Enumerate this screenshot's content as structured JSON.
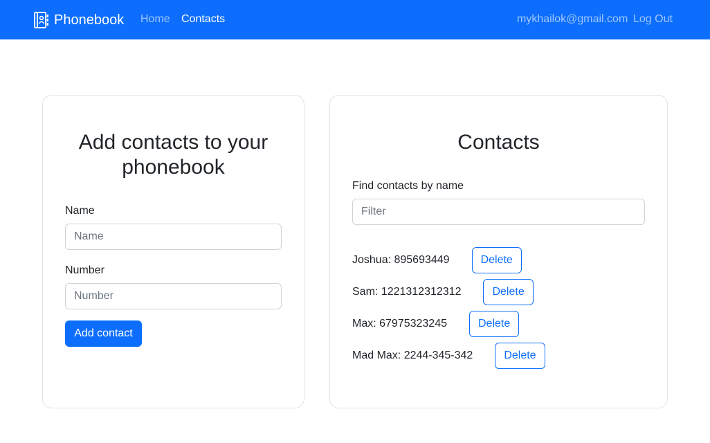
{
  "navbar": {
    "brand": "Phonebook",
    "links": [
      "Home",
      "Contacts"
    ],
    "user_email": "mykhailok@gmail.com",
    "logout": "Log Out",
    "bg_color": "#0d6efd"
  },
  "add_form": {
    "title": "Add contacts to your phonebook",
    "name_label": "Name",
    "name_placeholder": "Name",
    "name_value": "",
    "number_label": "Number",
    "number_placeholder": "Number",
    "number_value": "",
    "submit_label": "Add contact"
  },
  "contacts": {
    "title": "Contacts",
    "filter_label": "Find contacts by name",
    "filter_placeholder": "Filter",
    "filter_value": "",
    "delete_label": "Delete",
    "items": [
      {
        "text": "Joshua: 895693449"
      },
      {
        "text": "Sam: 1221312312312"
      },
      {
        "text": "Max: 67975323245"
      },
      {
        "text": "Mad Max: 2244-345-342"
      }
    ]
  }
}
